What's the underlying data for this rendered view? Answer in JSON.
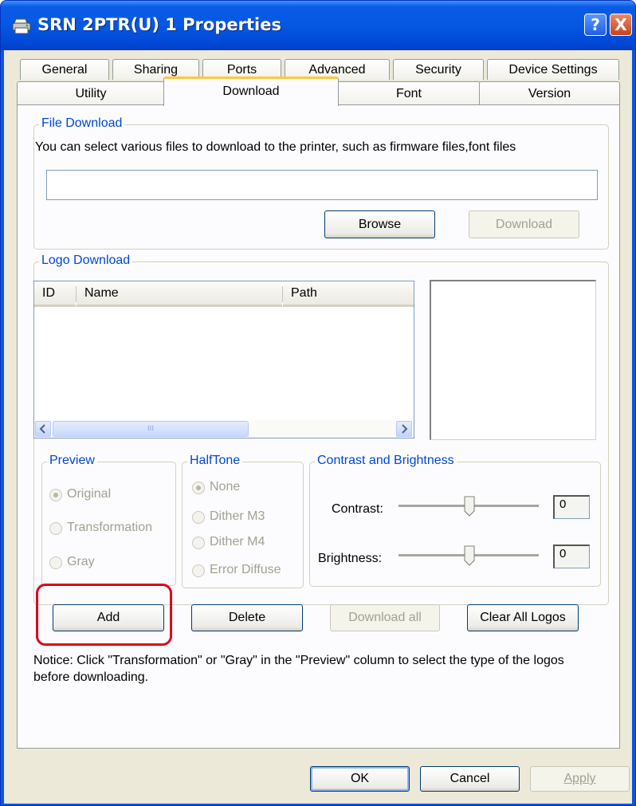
{
  "window": {
    "title": "SRN 2PTR(U) 1 Properties",
    "help_glyph": "?",
    "close_glyph": "X"
  },
  "tabs_row1": [
    "General",
    "Sharing",
    "Ports",
    "Advanced",
    "Security",
    "Device Settings"
  ],
  "tabs_row2": [
    "Utility",
    "Download",
    "Font",
    "Version"
  ],
  "active_tab": "Download",
  "file_download": {
    "legend": "File Download",
    "description": "You can select various files to download to the printer, such as firmware files,font files",
    "path_value": "",
    "browse_label": "Browse",
    "download_label": "Download"
  },
  "logo_download": {
    "legend": "Logo Download",
    "columns": [
      "ID",
      "Name",
      "Path"
    ],
    "rows": [],
    "scroll_thumb_glyph": "III"
  },
  "preview": {
    "legend": "Preview",
    "options": [
      "Original",
      "Transformation",
      "Gray"
    ],
    "selected": "Original"
  },
  "halftone": {
    "legend": "HalfTone",
    "options": [
      "None",
      "Dither M3",
      "Dither M4",
      "Error Diffuse"
    ],
    "selected": "None"
  },
  "contrast_brightness": {
    "legend": "Contrast and Brightness",
    "contrast_label": "Contrast:",
    "contrast_value": "0",
    "brightness_label": "Brightness:",
    "brightness_value": "0"
  },
  "logo_buttons": {
    "add": "Add",
    "delete": "Delete",
    "download_all": "Download all",
    "clear_all": "Clear All Logos"
  },
  "notice": "Notice: Click \"Transformation\" or \"Gray\" in the \"Preview\" column to select the type of the logos before downloading.",
  "dialog_buttons": {
    "ok": "OK",
    "cancel": "Cancel",
    "apply": "Apply"
  },
  "colors": {
    "titlebar": "#0558e2",
    "group_label": "#0046d5",
    "highlight": "#e0001b",
    "active_tab_accent": "#ffc83c"
  },
  "icons": [
    "printer-icon",
    "help-icon",
    "close-icon",
    "scroll-left-icon",
    "scroll-right-icon",
    "slider-thumb-icon"
  ]
}
